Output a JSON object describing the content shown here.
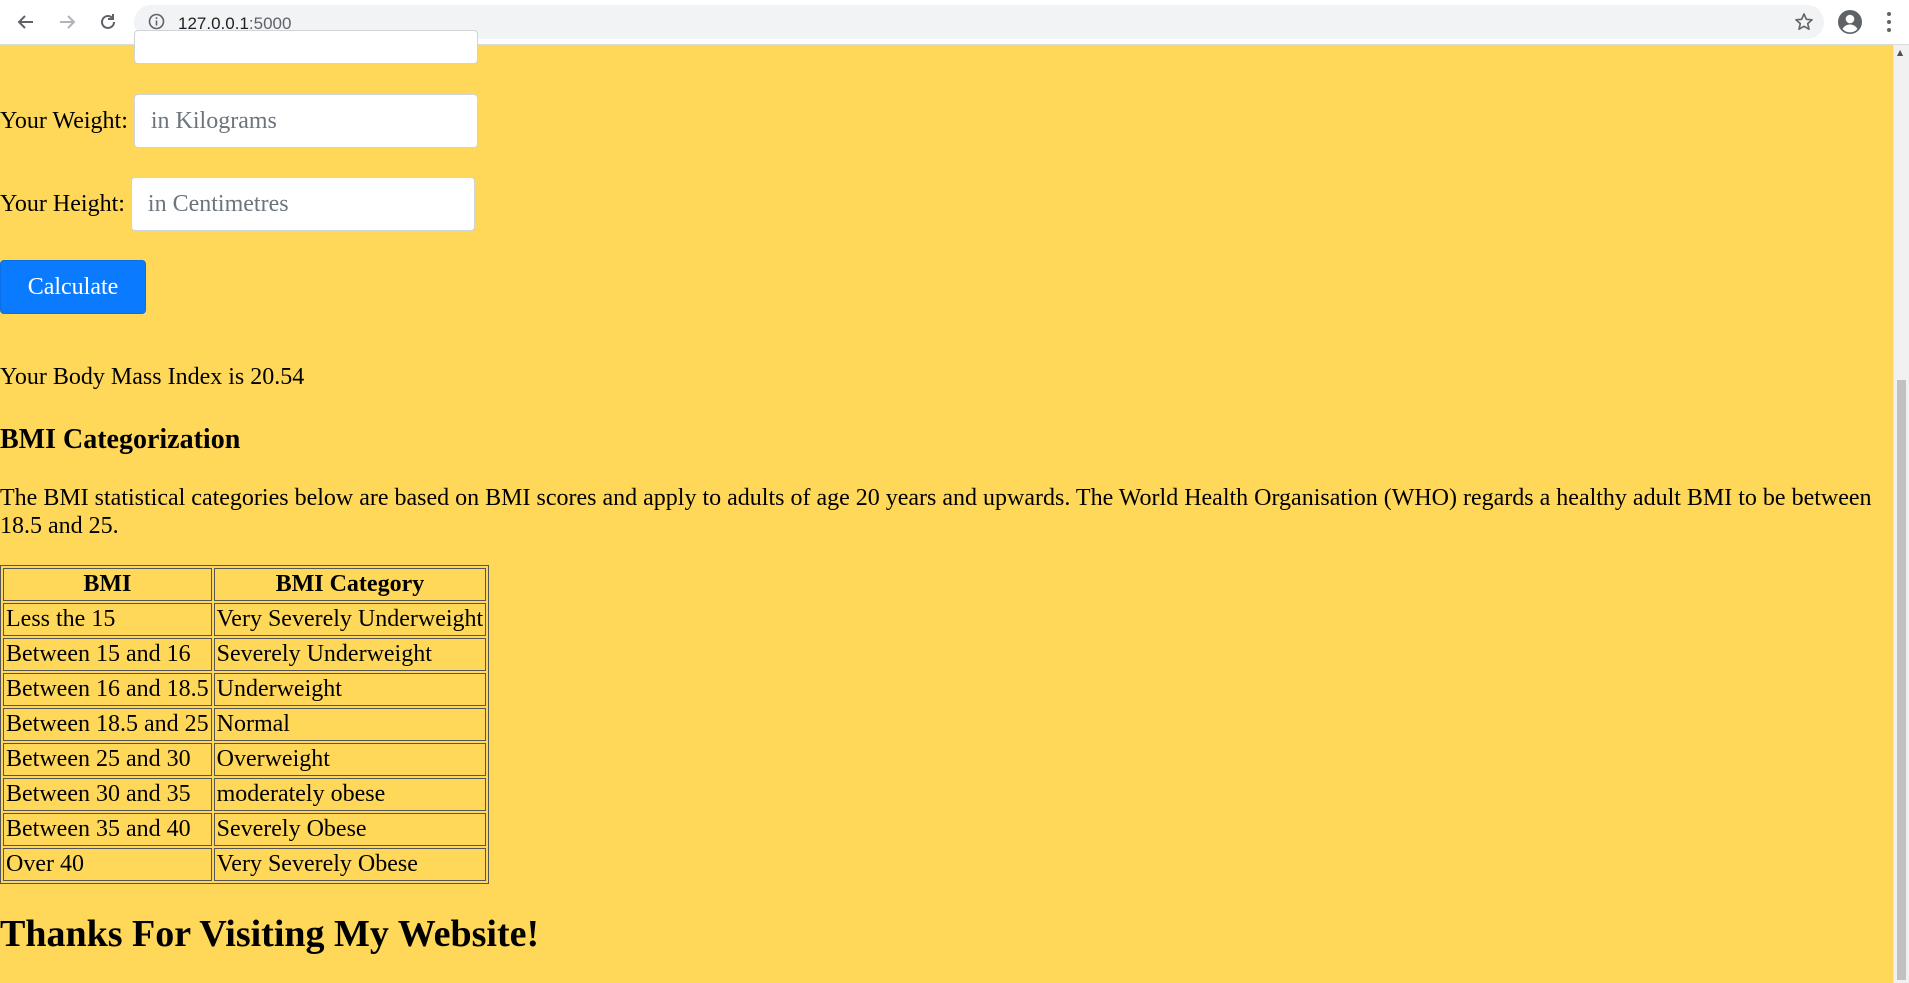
{
  "browser": {
    "url_host": "127.0.0.1",
    "url_port": ":5000"
  },
  "form": {
    "weight_label": "Your Weight:",
    "weight_placeholder": "in Kilograms",
    "height_label": "Your Height:",
    "height_placeholder": "in Centimetres",
    "calculate_label": "Calculate"
  },
  "result_text": "Your Body Mass Index is 20.54",
  "categorization": {
    "heading": "BMI Categorization",
    "description": "The BMI statistical categories below are based on BMI scores and apply to adults of age 20 years and upwards. The World Health Organisation (WHO) regards a healthy adult BMI to be between 18.5 and 25.",
    "table": {
      "headers": [
        "BMI",
        "BMI Category"
      ],
      "rows": [
        [
          "Less the 15",
          "Very Severely Underweight"
        ],
        [
          "Between 15 and 16",
          "Severely Underweight"
        ],
        [
          "Between 16 and 18.5",
          "Underweight"
        ],
        [
          "Between 18.5 and 25",
          "Normal"
        ],
        [
          "Between 25 and 30",
          "Overweight"
        ],
        [
          "Between 30 and 35",
          "moderately obese"
        ],
        [
          "Between 35 and 40",
          "Severely Obese"
        ],
        [
          "Over 40",
          "Very Severely Obese"
        ]
      ]
    }
  },
  "footer_text": "Thanks For Visiting My Website!",
  "colors": {
    "page_background": "#ffd859",
    "button_blue": "#0a7bff"
  },
  "icons": [
    "back-arrow-icon",
    "forward-arrow-icon",
    "reload-icon",
    "info-icon",
    "star-icon",
    "profile-icon",
    "kebab-menu-icon"
  ]
}
